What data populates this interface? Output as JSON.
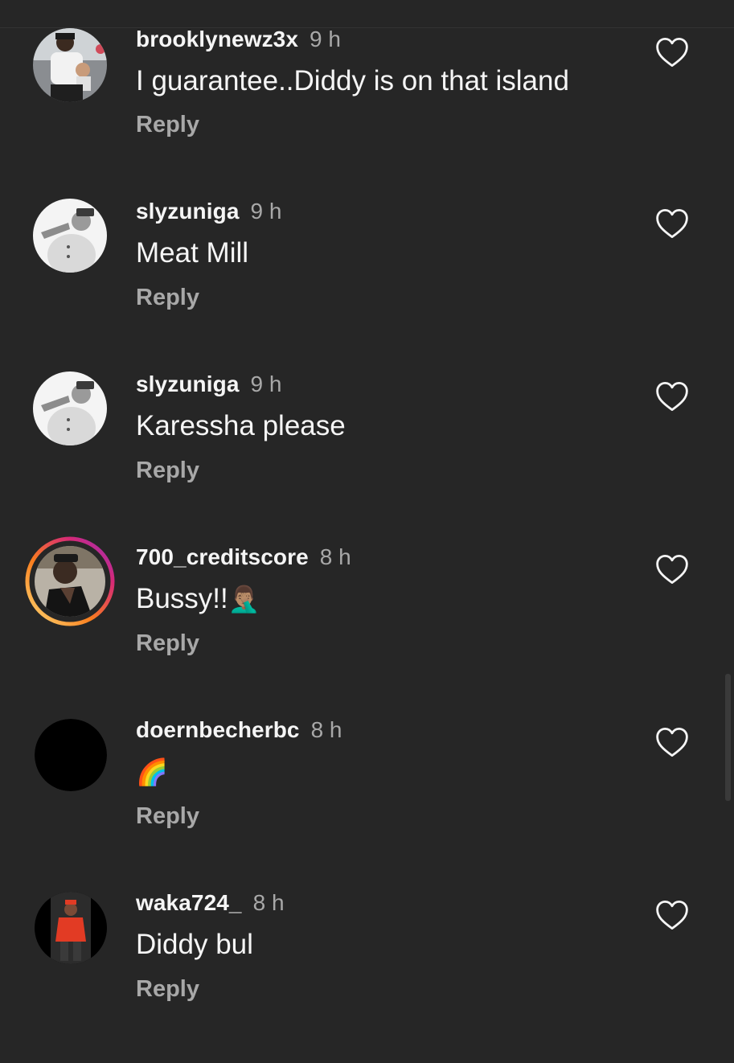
{
  "comments": [
    {
      "username": "brooklynewz3x",
      "time": "9 h",
      "text": "I guarantee..Diddy is on that island",
      "reply": "Reply",
      "avatar": "photo-man-with-child"
    },
    {
      "username": "slyzuniga",
      "time": "9 h",
      "text": "Meat Mill",
      "reply": "Reply",
      "avatar": "photo-man-with-cap"
    },
    {
      "username": "slyzuniga",
      "time": "9 h",
      "text": "Karessha please",
      "reply": "Reply",
      "avatar": "photo-man-with-cap"
    },
    {
      "username": "700_creditscore",
      "time": "8 h",
      "text": "Bussy!!",
      "emoji": "🤦🏽‍♂️",
      "reply": "Reply",
      "avatar": "photo-man-story-ring"
    },
    {
      "username": "doernbecherbc",
      "time": "8 h",
      "text": "",
      "emoji": "🌈",
      "reply": "Reply",
      "avatar": "black-circle"
    },
    {
      "username": "waka724_",
      "time": "8 h",
      "text": "Diddy bul",
      "reply": "Reply",
      "avatar": "photo-man-red-jacket"
    }
  ],
  "icons": {
    "like": "heart-outline-icon"
  },
  "colors": {
    "background": "#262626",
    "primary_text": "#f5f5f5",
    "secondary_text": "#a8a8a8",
    "story_ring_start": "#feda75",
    "story_ring_end": "#d62976"
  }
}
